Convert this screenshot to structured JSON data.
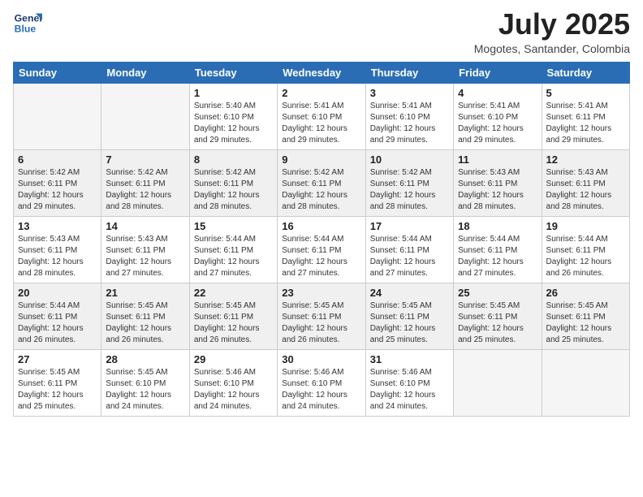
{
  "header": {
    "logo_line1": "General",
    "logo_line2": "Blue",
    "month_title": "July 2025",
    "location": "Mogotes, Santander, Colombia"
  },
  "weekdays": [
    "Sunday",
    "Monday",
    "Tuesday",
    "Wednesday",
    "Thursday",
    "Friday",
    "Saturday"
  ],
  "weeks": [
    [
      {
        "day": "",
        "info": ""
      },
      {
        "day": "",
        "info": ""
      },
      {
        "day": "1",
        "info": "Sunrise: 5:40 AM\nSunset: 6:10 PM\nDaylight: 12 hours and 29 minutes."
      },
      {
        "day": "2",
        "info": "Sunrise: 5:41 AM\nSunset: 6:10 PM\nDaylight: 12 hours and 29 minutes."
      },
      {
        "day": "3",
        "info": "Sunrise: 5:41 AM\nSunset: 6:10 PM\nDaylight: 12 hours and 29 minutes."
      },
      {
        "day": "4",
        "info": "Sunrise: 5:41 AM\nSunset: 6:10 PM\nDaylight: 12 hours and 29 minutes."
      },
      {
        "day": "5",
        "info": "Sunrise: 5:41 AM\nSunset: 6:11 PM\nDaylight: 12 hours and 29 minutes."
      }
    ],
    [
      {
        "day": "6",
        "info": "Sunrise: 5:42 AM\nSunset: 6:11 PM\nDaylight: 12 hours and 29 minutes."
      },
      {
        "day": "7",
        "info": "Sunrise: 5:42 AM\nSunset: 6:11 PM\nDaylight: 12 hours and 28 minutes."
      },
      {
        "day": "8",
        "info": "Sunrise: 5:42 AM\nSunset: 6:11 PM\nDaylight: 12 hours and 28 minutes."
      },
      {
        "day": "9",
        "info": "Sunrise: 5:42 AM\nSunset: 6:11 PM\nDaylight: 12 hours and 28 minutes."
      },
      {
        "day": "10",
        "info": "Sunrise: 5:42 AM\nSunset: 6:11 PM\nDaylight: 12 hours and 28 minutes."
      },
      {
        "day": "11",
        "info": "Sunrise: 5:43 AM\nSunset: 6:11 PM\nDaylight: 12 hours and 28 minutes."
      },
      {
        "day": "12",
        "info": "Sunrise: 5:43 AM\nSunset: 6:11 PM\nDaylight: 12 hours and 28 minutes."
      }
    ],
    [
      {
        "day": "13",
        "info": "Sunrise: 5:43 AM\nSunset: 6:11 PM\nDaylight: 12 hours and 28 minutes."
      },
      {
        "day": "14",
        "info": "Sunrise: 5:43 AM\nSunset: 6:11 PM\nDaylight: 12 hours and 27 minutes."
      },
      {
        "day": "15",
        "info": "Sunrise: 5:44 AM\nSunset: 6:11 PM\nDaylight: 12 hours and 27 minutes."
      },
      {
        "day": "16",
        "info": "Sunrise: 5:44 AM\nSunset: 6:11 PM\nDaylight: 12 hours and 27 minutes."
      },
      {
        "day": "17",
        "info": "Sunrise: 5:44 AM\nSunset: 6:11 PM\nDaylight: 12 hours and 27 minutes."
      },
      {
        "day": "18",
        "info": "Sunrise: 5:44 AM\nSunset: 6:11 PM\nDaylight: 12 hours and 27 minutes."
      },
      {
        "day": "19",
        "info": "Sunrise: 5:44 AM\nSunset: 6:11 PM\nDaylight: 12 hours and 26 minutes."
      }
    ],
    [
      {
        "day": "20",
        "info": "Sunrise: 5:44 AM\nSunset: 6:11 PM\nDaylight: 12 hours and 26 minutes."
      },
      {
        "day": "21",
        "info": "Sunrise: 5:45 AM\nSunset: 6:11 PM\nDaylight: 12 hours and 26 minutes."
      },
      {
        "day": "22",
        "info": "Sunrise: 5:45 AM\nSunset: 6:11 PM\nDaylight: 12 hours and 26 minutes."
      },
      {
        "day": "23",
        "info": "Sunrise: 5:45 AM\nSunset: 6:11 PM\nDaylight: 12 hours and 26 minutes."
      },
      {
        "day": "24",
        "info": "Sunrise: 5:45 AM\nSunset: 6:11 PM\nDaylight: 12 hours and 25 minutes."
      },
      {
        "day": "25",
        "info": "Sunrise: 5:45 AM\nSunset: 6:11 PM\nDaylight: 12 hours and 25 minutes."
      },
      {
        "day": "26",
        "info": "Sunrise: 5:45 AM\nSunset: 6:11 PM\nDaylight: 12 hours and 25 minutes."
      }
    ],
    [
      {
        "day": "27",
        "info": "Sunrise: 5:45 AM\nSunset: 6:11 PM\nDaylight: 12 hours and 25 minutes."
      },
      {
        "day": "28",
        "info": "Sunrise: 5:45 AM\nSunset: 6:10 PM\nDaylight: 12 hours and 24 minutes."
      },
      {
        "day": "29",
        "info": "Sunrise: 5:46 AM\nSunset: 6:10 PM\nDaylight: 12 hours and 24 minutes."
      },
      {
        "day": "30",
        "info": "Sunrise: 5:46 AM\nSunset: 6:10 PM\nDaylight: 12 hours and 24 minutes."
      },
      {
        "day": "31",
        "info": "Sunrise: 5:46 AM\nSunset: 6:10 PM\nDaylight: 12 hours and 24 minutes."
      },
      {
        "day": "",
        "info": ""
      },
      {
        "day": "",
        "info": ""
      }
    ]
  ]
}
